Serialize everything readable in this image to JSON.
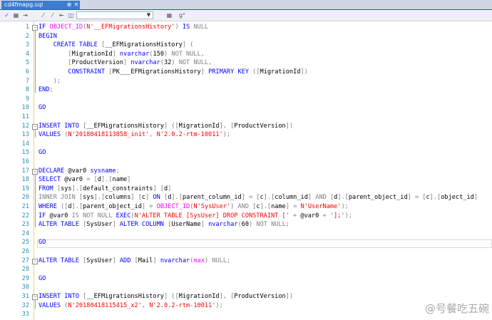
{
  "tab": {
    "title": "cd4fmapg.sql",
    "pin_glyph": "⊕",
    "close_glyph": "✕"
  },
  "toolbar": {
    "icons": [
      {
        "name": "checkmark-icon",
        "glyph": "✓"
      },
      {
        "name": "grid-results-icon",
        "glyph": "▦"
      },
      {
        "name": "indent-icon",
        "glyph": "⇥"
      },
      {
        "name": "comment-icon",
        "glyph": "⁄"
      },
      {
        "name": "uncomment-icon",
        "glyph": "⁄"
      },
      {
        "name": "outdent-icon",
        "glyph": "⇤"
      },
      {
        "name": "toggle-icon",
        "glyph": "◫"
      },
      {
        "name": "table-icon",
        "glyph": "▦"
      },
      {
        "name": "format-icon",
        "glyph": "g°"
      }
    ],
    "combo_value": ""
  },
  "lines": [
    {
      "n": "1",
      "segments": [
        [
          "kw",
          "IF "
        ],
        [
          "fn",
          "OBJECT_ID"
        ],
        [
          "gr",
          "("
        ],
        [
          "str",
          "N'__EFMigrationsHistory'"
        ],
        [
          "gr",
          ") "
        ],
        [
          "kw",
          "IS "
        ],
        [
          "gr",
          "NULL"
        ]
      ]
    },
    {
      "n": "2",
      "segments": [
        [
          "kw",
          "BEGIN"
        ]
      ]
    },
    {
      "n": "3",
      "segments": [
        [
          "",
          "    "
        ],
        [
          "kw",
          "CREATE TABLE "
        ],
        [
          "gr",
          "["
        ],
        [
          "",
          "__EFMigrationsHistory"
        ],
        [
          "gr",
          "] ("
        ]
      ]
    },
    {
      "n": "4",
      "segments": [
        [
          "",
          "        "
        ],
        [
          "gr",
          "["
        ],
        [
          "",
          "MigrationId"
        ],
        [
          "gr",
          "] "
        ],
        [
          "kw",
          "nvarchar"
        ],
        [
          "gr",
          "("
        ],
        [
          "",
          "150"
        ],
        [
          "gr",
          ") "
        ],
        [
          "gr",
          "NOT NULL"
        ],
        [
          "gr",
          ","
        ]
      ]
    },
    {
      "n": "5",
      "segments": [
        [
          "",
          "        "
        ],
        [
          "gr",
          "["
        ],
        [
          "",
          "ProductVersion"
        ],
        [
          "gr",
          "] "
        ],
        [
          "kw",
          "nvarchar"
        ],
        [
          "gr",
          "("
        ],
        [
          "",
          "32"
        ],
        [
          "gr",
          ") "
        ],
        [
          "gr",
          "NOT NULL"
        ],
        [
          "gr",
          ","
        ]
      ]
    },
    {
      "n": "6",
      "segments": [
        [
          "",
          "        "
        ],
        [
          "kw",
          "CONSTRAINT "
        ],
        [
          "gr",
          "["
        ],
        [
          "",
          "PK___EFMigrationsHistory"
        ],
        [
          "gr",
          "] "
        ],
        [
          "kw",
          "PRIMARY KEY "
        ],
        [
          "gr",
          "(["
        ],
        [
          "",
          "MigrationId"
        ],
        [
          "gr",
          "])"
        ]
      ]
    },
    {
      "n": "7",
      "segments": [
        [
          "",
          "    "
        ],
        [
          "gr",
          ");"
        ]
      ]
    },
    {
      "n": "8",
      "segments": [
        [
          "kw",
          "END"
        ],
        [
          "gr",
          ";"
        ]
      ]
    },
    {
      "n": "9",
      "segments": []
    },
    {
      "n": "10",
      "segments": [
        [
          "kw",
          "GO"
        ]
      ]
    },
    {
      "n": "11",
      "segments": []
    },
    {
      "n": "12",
      "segments": [
        [
          "kw",
          "INSERT INTO "
        ],
        [
          "gr",
          "["
        ],
        [
          "",
          "__EFMigrationsHistory"
        ],
        [
          "gr",
          "] (["
        ],
        [
          "",
          "MigrationId"
        ],
        [
          "gr",
          "], ["
        ],
        [
          "",
          "ProductVersion"
        ],
        [
          "gr",
          "])"
        ]
      ]
    },
    {
      "n": "13",
      "segments": [
        [
          "kw",
          "VALUES "
        ],
        [
          "gr",
          "("
        ],
        [
          "str",
          "N'20180418113858_init'"
        ],
        [
          "gr",
          ", "
        ],
        [
          "str",
          "N'2.0.2-rtm-10011'"
        ],
        [
          "gr",
          ");"
        ]
      ]
    },
    {
      "n": "14",
      "segments": []
    },
    {
      "n": "15",
      "segments": [
        [
          "kw",
          "GO"
        ]
      ]
    },
    {
      "n": "16",
      "segments": []
    },
    {
      "n": "17",
      "segments": [
        [
          "kw",
          "DECLARE "
        ],
        [
          "",
          "@var0 "
        ],
        [
          "kw",
          "sysname"
        ],
        [
          "gr",
          ";"
        ]
      ]
    },
    {
      "n": "18",
      "segments": [
        [
          "kw",
          "SELECT "
        ],
        [
          "",
          "@var0 "
        ],
        [
          "gr",
          "= ["
        ],
        [
          "",
          "d"
        ],
        [
          "gr",
          "].["
        ],
        [
          "",
          "name"
        ],
        [
          "gr",
          "]"
        ]
      ]
    },
    {
      "n": "19",
      "segments": [
        [
          "kw",
          "FROM "
        ],
        [
          "gr",
          "["
        ],
        [
          "",
          "sys"
        ],
        [
          "gr",
          "].["
        ],
        [
          "",
          "default_constraints"
        ],
        [
          "gr",
          "] ["
        ],
        [
          "",
          "d"
        ],
        [
          "gr",
          "]"
        ]
      ]
    },
    {
      "n": "20",
      "segments": [
        [
          "gr",
          "INNER JOIN "
        ],
        [
          "gr",
          "["
        ],
        [
          "",
          "sys"
        ],
        [
          "gr",
          "].["
        ],
        [
          "",
          "columns"
        ],
        [
          "gr",
          "] ["
        ],
        [
          "",
          "c"
        ],
        [
          "gr",
          "] "
        ],
        [
          "kw",
          "ON "
        ],
        [
          "gr",
          "["
        ],
        [
          "",
          "d"
        ],
        [
          "gr",
          "].["
        ],
        [
          "",
          "parent_column_id"
        ],
        [
          "gr",
          "] = ["
        ],
        [
          "",
          "c"
        ],
        [
          "gr",
          "].["
        ],
        [
          "",
          "column_id"
        ],
        [
          "gr",
          "] "
        ],
        [
          "gr",
          "AND "
        ],
        [
          "gr",
          "["
        ],
        [
          "",
          "d"
        ],
        [
          "gr",
          "].["
        ],
        [
          "",
          "parent_object_id"
        ],
        [
          "gr",
          "] = ["
        ],
        [
          "",
          "c"
        ],
        [
          "gr",
          "].["
        ],
        [
          "",
          "object_id"
        ],
        [
          "gr",
          "]"
        ]
      ]
    },
    {
      "n": "21",
      "segments": [
        [
          "kw",
          "WHERE "
        ],
        [
          "gr",
          "(["
        ],
        [
          "",
          "d"
        ],
        [
          "gr",
          "].["
        ],
        [
          "",
          "parent_object_id"
        ],
        [
          "gr",
          "] = "
        ],
        [
          "fn",
          "OBJECT_ID"
        ],
        [
          "gr",
          "("
        ],
        [
          "str",
          "N'SysUser'"
        ],
        [
          "gr",
          ") "
        ],
        [
          "gr",
          "AND "
        ],
        [
          "gr",
          "["
        ],
        [
          "",
          "c"
        ],
        [
          "gr",
          "].["
        ],
        [
          "",
          "name"
        ],
        [
          "gr",
          "] = "
        ],
        [
          "str",
          "N'UserName'"
        ],
        [
          "gr",
          ");"
        ]
      ]
    },
    {
      "n": "22",
      "segments": [
        [
          "kw",
          "IF "
        ],
        [
          "",
          "@var0 "
        ],
        [
          "gr",
          "IS NOT NULL "
        ],
        [
          "kw",
          "EXEC"
        ],
        [
          "gr",
          "("
        ],
        [
          "str",
          "N'ALTER TABLE [SysUser] DROP CONSTRAINT ['"
        ],
        [
          "gr",
          " + "
        ],
        [
          "",
          "@var0 "
        ],
        [
          "gr",
          "+ "
        ],
        [
          "str",
          "'];'"
        ],
        [
          "gr",
          ");"
        ]
      ]
    },
    {
      "n": "23",
      "segments": [
        [
          "kw",
          "ALTER TABLE "
        ],
        [
          "gr",
          "["
        ],
        [
          "",
          "SysUser"
        ],
        [
          "gr",
          "] "
        ],
        [
          "kw",
          "ALTER COLUMN "
        ],
        [
          "gr",
          "["
        ],
        [
          "",
          "UserName"
        ],
        [
          "gr",
          "] "
        ],
        [
          "kw",
          "nvarchar"
        ],
        [
          "gr",
          "("
        ],
        [
          "",
          "60"
        ],
        [
          "gr",
          ") "
        ],
        [
          "gr",
          "NOT NULL"
        ],
        [
          "gr",
          ";"
        ]
      ]
    },
    {
      "n": "24",
      "segments": []
    },
    {
      "n": "25",
      "segments": [
        [
          "kw",
          "GO"
        ]
      ]
    },
    {
      "n": "26",
      "segments": []
    },
    {
      "n": "27",
      "segments": [
        [
          "kw",
          "ALTER TABLE "
        ],
        [
          "gr",
          "["
        ],
        [
          "",
          "SysUser"
        ],
        [
          "gr",
          "] "
        ],
        [
          "kw",
          "ADD "
        ],
        [
          "gr",
          "["
        ],
        [
          "",
          "Mail"
        ],
        [
          "gr",
          "] "
        ],
        [
          "kw",
          "nvarchar"
        ],
        [
          "gr",
          "("
        ],
        [
          "fn",
          "max"
        ],
        [
          "gr",
          ") "
        ],
        [
          "gr",
          "NULL"
        ],
        [
          "gr",
          ";"
        ]
      ]
    },
    {
      "n": "28",
      "segments": []
    },
    {
      "n": "29",
      "segments": [
        [
          "kw",
          "GO"
        ]
      ]
    },
    {
      "n": "30",
      "segments": []
    },
    {
      "n": "31",
      "segments": [
        [
          "kw",
          "INSERT INTO "
        ],
        [
          "gr",
          "["
        ],
        [
          "",
          "__EFMigrationsHistory"
        ],
        [
          "gr",
          "] (["
        ],
        [
          "",
          "MigrationId"
        ],
        [
          "gr",
          "], ["
        ],
        [
          "",
          "ProductVersion"
        ],
        [
          "gr",
          "])"
        ]
      ]
    },
    {
      "n": "32",
      "segments": [
        [
          "kw",
          "VALUES "
        ],
        [
          "gr",
          "("
        ],
        [
          "str",
          "N'20180418115415_x2'"
        ],
        [
          "gr",
          ", "
        ],
        [
          "str",
          "N'2.0.2-rtm-10011'"
        ],
        [
          "gr",
          ");"
        ]
      ]
    },
    {
      "n": "33",
      "segments": []
    }
  ],
  "watermark": "@号餐吃五碗",
  "colors": {
    "keyword": "#0000ff",
    "function": "#ff00ff",
    "string": "#ff0000",
    "operator": "#808080",
    "line_number": "#2b91af",
    "tab_active": "#3d7cd1"
  }
}
